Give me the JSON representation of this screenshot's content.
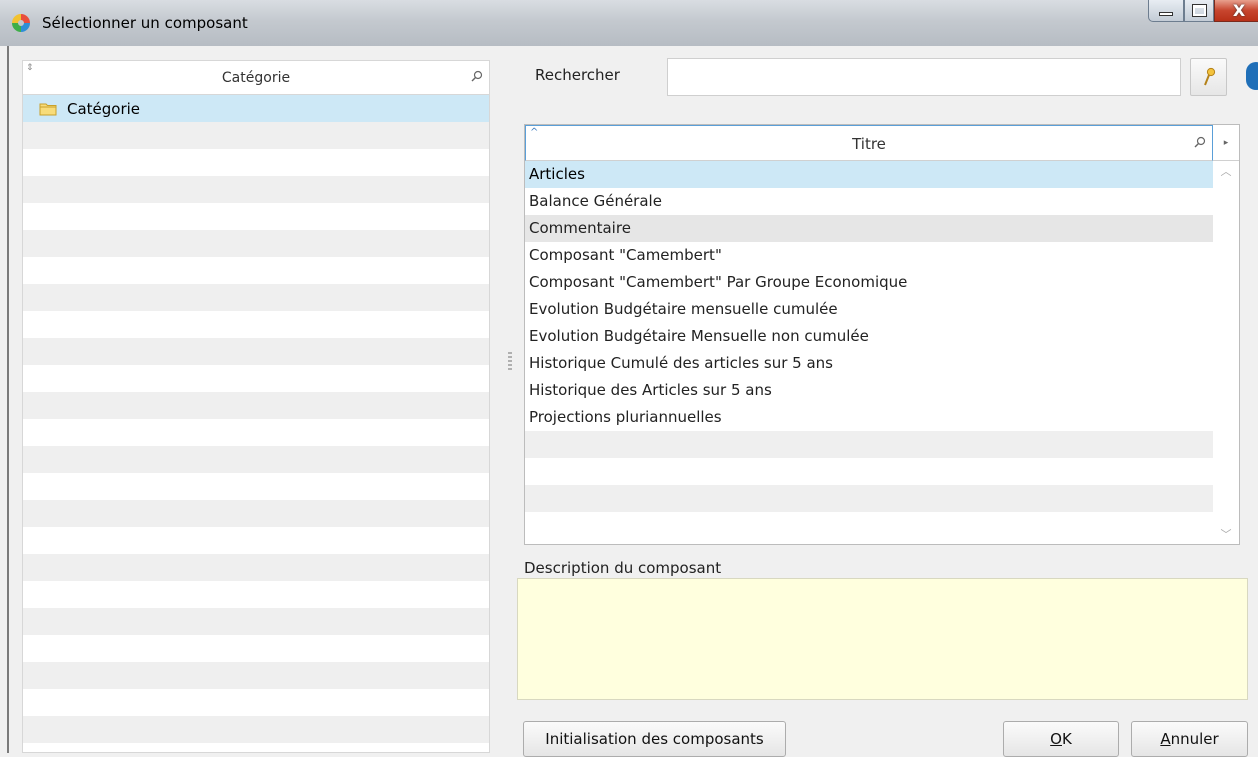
{
  "window": {
    "title": "Sélectionner un composant",
    "controls": {
      "minimize": "minimize",
      "maximize": "maximize",
      "close": "X"
    }
  },
  "category_panel": {
    "header": "Catégorie",
    "items": [
      {
        "label": "Catégorie",
        "icon": "folder-icon",
        "selected": true
      }
    ]
  },
  "search": {
    "label": "Rechercher",
    "value": "",
    "placeholder": ""
  },
  "grid": {
    "column_header": "Titre",
    "rows": [
      "Articles",
      "Balance Générale",
      "Commentaire",
      "Composant \"Camembert\"",
      "Composant \"Camembert\" Par Groupe Economique",
      "Evolution Budgétaire mensuelle cumulée",
      "Evolution Budgétaire Mensuelle non cumulée",
      "Historique Cumulé des articles sur 5 ans",
      "Historique des Articles sur 5 ans",
      "Projections pluriannuelles"
    ],
    "selected_index": 0,
    "hover_index": 2
  },
  "description": {
    "label": "Description du composant",
    "value": ""
  },
  "buttons": {
    "init": "Initialisation des composants",
    "ok_mnemonic": "O",
    "ok_rest": "K",
    "cancel_mnemonic": "A",
    "cancel_rest": "nnuler"
  },
  "colors": {
    "selection": "#cde8f6",
    "description_bg": "#ffffde",
    "row_alt": "#efefef"
  }
}
